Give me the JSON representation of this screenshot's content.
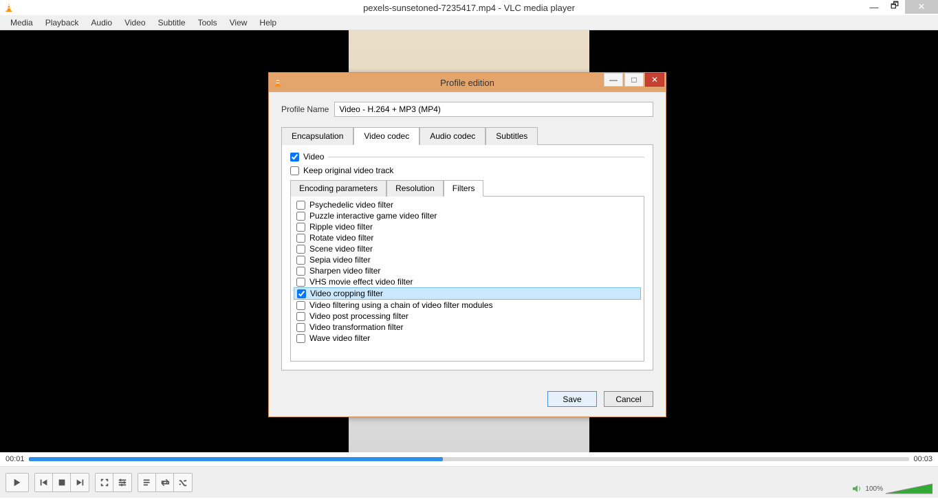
{
  "window": {
    "title": "pexels-sunsetoned-7235417.mp4 - VLC media player"
  },
  "menu": {
    "items": [
      "Media",
      "Playback",
      "Audio",
      "Video",
      "Subtitle",
      "Tools",
      "View",
      "Help"
    ]
  },
  "playback": {
    "current_time": "00:01",
    "total_time": "00:03",
    "volume_text": "100%"
  },
  "dialog": {
    "title": "Profile edition",
    "profile_label": "Profile Name",
    "profile_value": "Video - H.264 + MP3 (MP4)",
    "main_tabs": [
      "Encapsulation",
      "Video codec",
      "Audio codec",
      "Subtitles"
    ],
    "video_checkbox": "Video",
    "keep_track": "Keep original video track",
    "sub_tabs": [
      "Encoding parameters",
      "Resolution",
      "Filters"
    ],
    "filters": [
      {
        "label": "Psychedelic video filter",
        "checked": false,
        "selected": false
      },
      {
        "label": "Puzzle interactive game video filter",
        "checked": false,
        "selected": false
      },
      {
        "label": "Ripple video filter",
        "checked": false,
        "selected": false
      },
      {
        "label": "Rotate video filter",
        "checked": false,
        "selected": false
      },
      {
        "label": "Scene video filter",
        "checked": false,
        "selected": false
      },
      {
        "label": "Sepia video filter",
        "checked": false,
        "selected": false
      },
      {
        "label": "Sharpen video filter",
        "checked": false,
        "selected": false
      },
      {
        "label": "VHS movie effect video filter",
        "checked": false,
        "selected": false
      },
      {
        "label": "Video cropping filter",
        "checked": true,
        "selected": true
      },
      {
        "label": "Video filtering using a chain of video filter modules",
        "checked": false,
        "selected": false
      },
      {
        "label": "Video post processing filter",
        "checked": false,
        "selected": false
      },
      {
        "label": "Video transformation filter",
        "checked": false,
        "selected": false
      },
      {
        "label": "Wave video filter",
        "checked": false,
        "selected": false
      }
    ],
    "save": "Save",
    "cancel": "Cancel"
  }
}
